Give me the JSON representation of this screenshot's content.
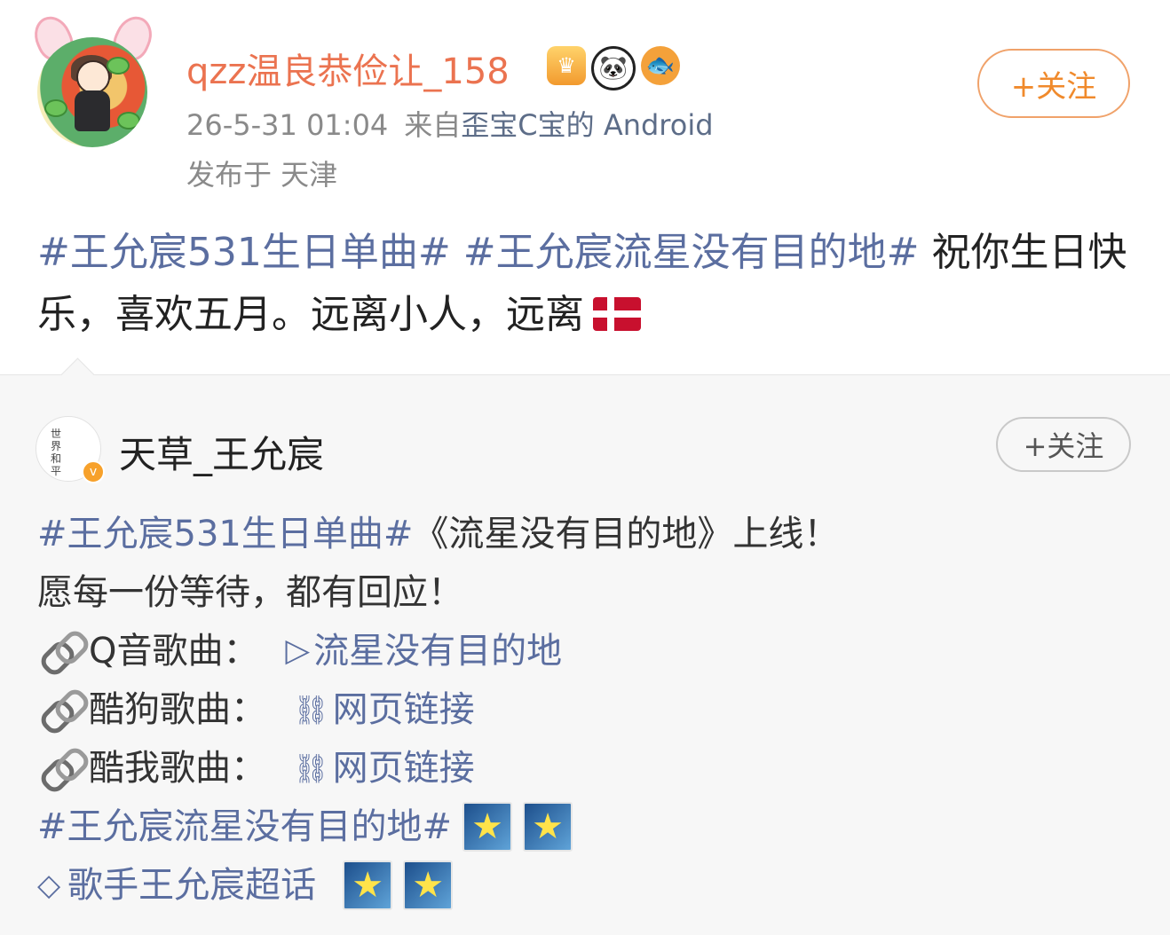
{
  "post": {
    "username": "qzz温良恭俭让_158",
    "badges": [
      "crown-badge",
      "panda-badge",
      "fish-badge"
    ],
    "timestamp": "26-5-31 01:04",
    "source_prefix": "来自",
    "source_name": "歪宝C宝的 Android",
    "location": "发布于 天津",
    "follow_label": "+关注",
    "text": {
      "topic1": "#王允宸531生日单曲#",
      "topic2": "#王允宸流星没有目的地#",
      "body": " 祝你生日快乐，喜欢五月。远离小人，远离"
    }
  },
  "retweet": {
    "author_name": "天草_王允宸",
    "avatar_text": "世界和平",
    "follow_label": "+关注",
    "lines": {
      "l1_topic": "#王允宸531生日单曲#",
      "l1_text": "《流星没有目的地》上线！",
      "l2_text": "愿每一份等待，都有回应！",
      "l3_label": "Q音歌曲：",
      "l3_link": "流星没有目的地",
      "l4_label": "酷狗歌曲：",
      "l4_link": "网页链接",
      "l5_label": "酷我歌曲：",
      "l5_link": "网页链接",
      "l6_topic": "#王允宸流星没有目的地#",
      "l7_super": "歌手王允宸超话"
    }
  },
  "colors": {
    "username": "#eb7350",
    "topic": "#5b6ea0",
    "follow_border": "#f0a26a",
    "retweet_bg": "#f7f7f7"
  }
}
